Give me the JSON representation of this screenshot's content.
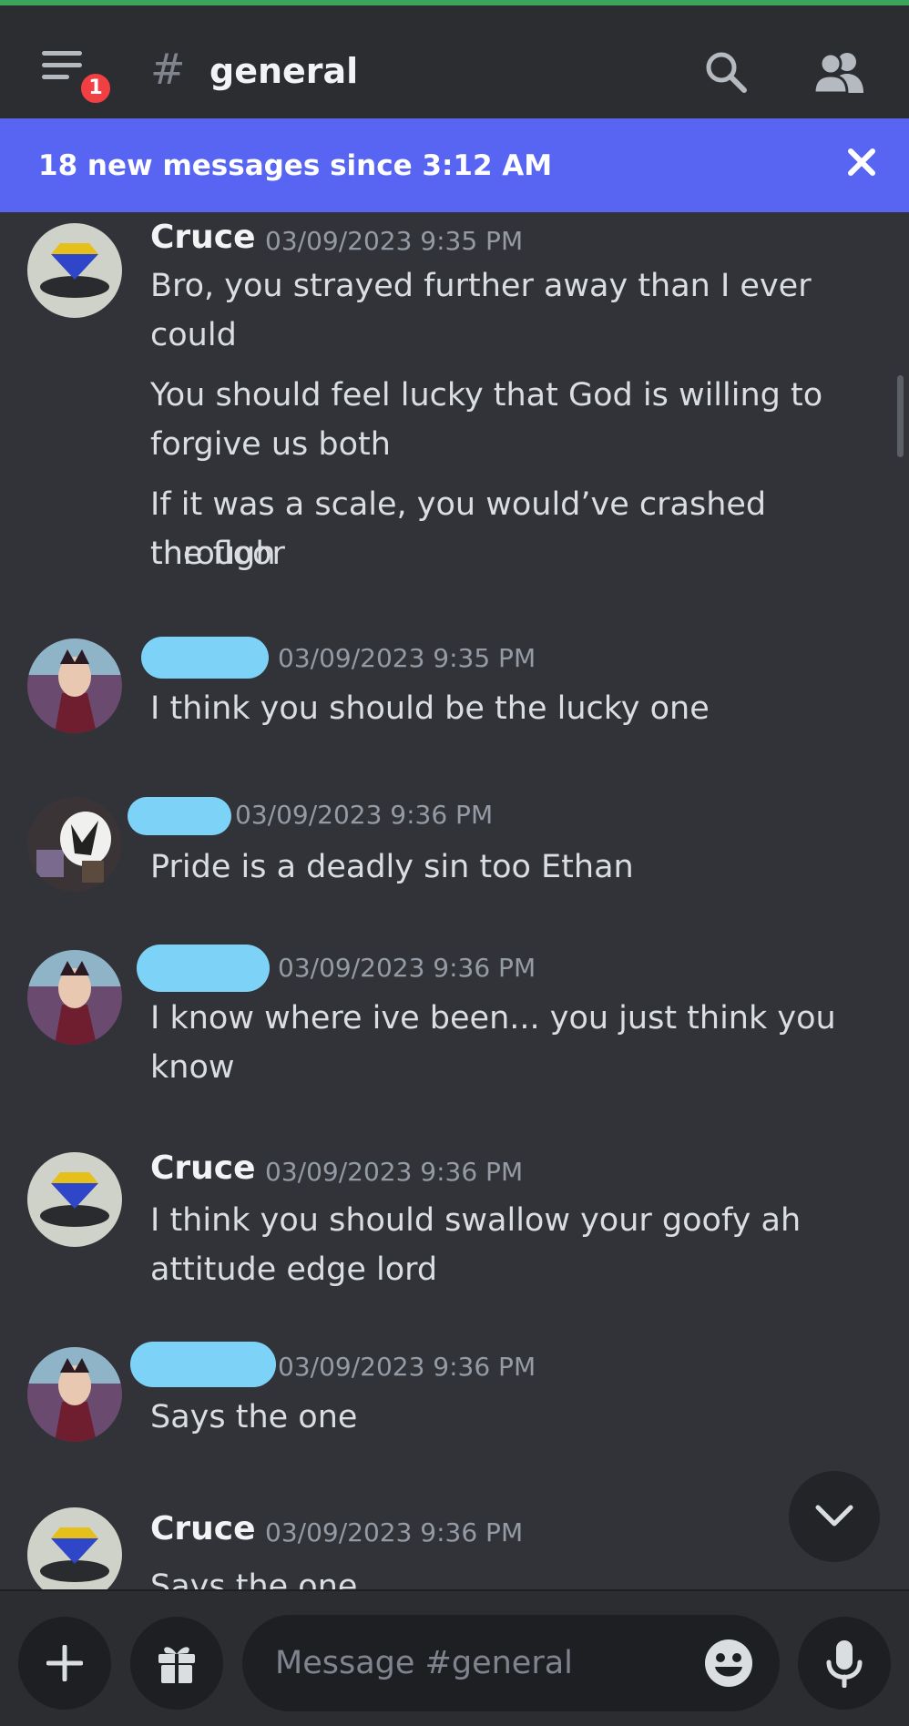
{
  "header": {
    "unread_count": "1",
    "hash_symbol": "#",
    "channel_name": "general"
  },
  "banner": {
    "text": "18 new messages since 3:12 AM"
  },
  "messages": [
    {
      "author": "Cruce",
      "timestamp": "03/09/2023 9:35 PM",
      "lines": [
        "Bro, you strayed further away than I ever",
        "could",
        "You should feel lucky that God is willing to",
        "forgive us both",
        "If it was a scale, you would’ve crashed through",
        "the floor"
      ]
    },
    {
      "author": "",
      "timestamp": "03/09/2023 9:35 PM",
      "lines": [
        "I think you should be the lucky one"
      ]
    },
    {
      "author": "",
      "timestamp": "03/09/2023 9:36 PM",
      "lines": [
        "Pride is a deadly sin too Ethan"
      ]
    },
    {
      "author": "",
      "timestamp": "03/09/2023 9:36 PM",
      "lines": [
        "I know where ive been... you just think you",
        "know"
      ]
    },
    {
      "author": "Cruce",
      "timestamp": "03/09/2023 9:36 PM",
      "lines": [
        "I think you should swallow your goofy ah",
        "attitude edge lord"
      ]
    },
    {
      "author": "",
      "timestamp": "03/09/2023 9:36 PM",
      "lines": [
        "Says the one"
      ]
    },
    {
      "author": "Cruce",
      "timestamp": "03/09/2023 9:36 PM",
      "lines": [
        "Says the one"
      ]
    }
  ],
  "composer": {
    "placeholder": "Message #general"
  },
  "icons": {
    "menu": "hamburger-menu-icon",
    "search": "search-icon",
    "members": "members-icon",
    "close": "close-icon",
    "add": "plus-icon",
    "gift": "gift-icon",
    "emoji": "emoji-icon",
    "mic": "microphone-icon",
    "jump": "chevron-down-icon"
  },
  "colors": {
    "background": "#313338",
    "header": "#2b2d31",
    "banner": "#5865f2",
    "badge": "#f23f43",
    "redaction": "#7dd3f7"
  }
}
